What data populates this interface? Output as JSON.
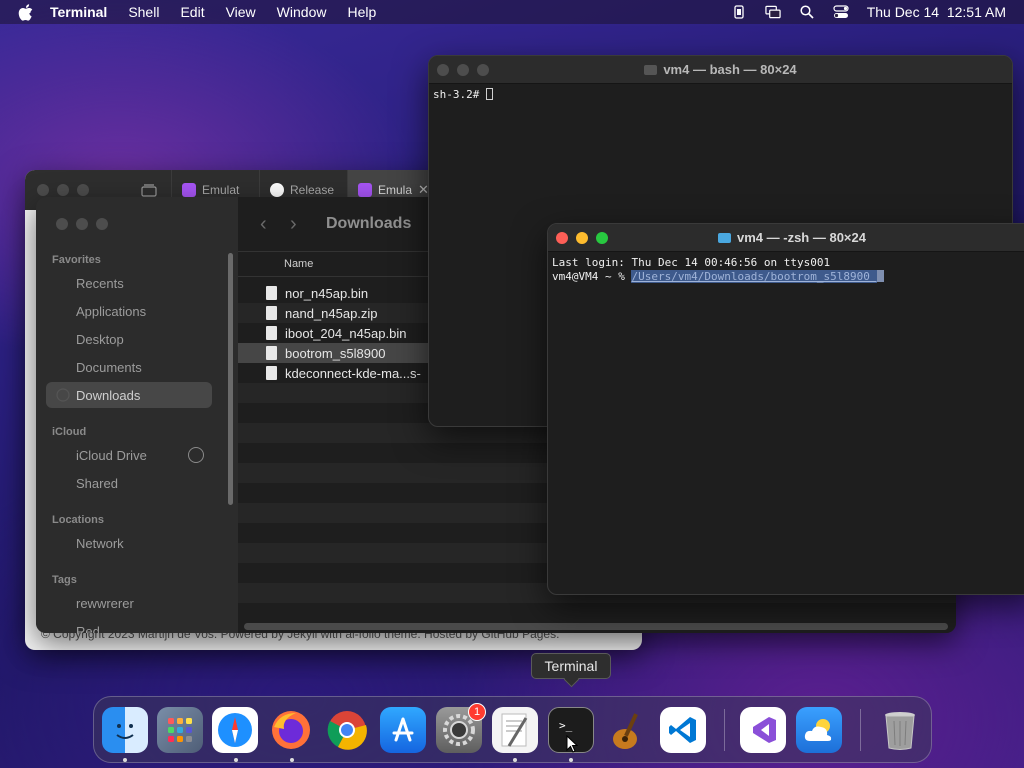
{
  "menubar": {
    "app_name": "Terminal",
    "items": [
      "Shell",
      "Edit",
      "View",
      "Window",
      "Help"
    ],
    "status_icons": [
      "battery-icon",
      "screen-mirroring-icon",
      "spotlight-icon",
      "control-center-icon"
    ],
    "datetime": "Thu Dec 14  12:51 AM"
  },
  "safari": {
    "tabs": [
      {
        "label": "Emulat",
        "favicon_color": "#a855f7"
      },
      {
        "label": "Release",
        "favicon_color": "#ffffff"
      },
      {
        "label": "Emula",
        "favicon_color": "#a855f7"
      }
    ],
    "footer_text": "© Copyright 2023 Martijn de Vos. Powered by Jekyll with al-folio theme. Hosted by GitHub Pages."
  },
  "finder": {
    "location_title": "Downloads",
    "column_name": "Name",
    "sections": {
      "favorites": "Favorites",
      "icloud": "iCloud",
      "locations": "Locations",
      "tags": "Tags"
    },
    "favorites": [
      "Recents",
      "Applications",
      "Desktop",
      "Documents",
      "Downloads"
    ],
    "icloud": [
      "iCloud Drive",
      "Shared"
    ],
    "locations": [
      "Network"
    ],
    "tags": [
      "rewwrerer",
      "Red"
    ],
    "files": [
      "nor_n45ap.bin",
      "nand_n45ap.zip",
      "iboot_204_n45ap.bin",
      "bootrom_s5l8900",
      "kdeconnect-kde-ma...s-"
    ]
  },
  "terminal_bash": {
    "title": "vm4 — bash — 80×24",
    "prompt": "sh-3.2# "
  },
  "terminal_zsh": {
    "title": "vm4 — -zsh — 80×24",
    "last_login": "Last login: Thu Dec 14 00:46:56 on ttys001",
    "prompt": "vm4@VM4 ~ % ",
    "selected_path": "/Users/vm4/Downloads/bootrom_s5l8900 "
  },
  "tooltip": "Terminal",
  "dock": {
    "settings_badge": "1"
  },
  "colors": {
    "close": "#fe5f57",
    "minimize": "#febc2e",
    "zoom": "#28c840"
  }
}
